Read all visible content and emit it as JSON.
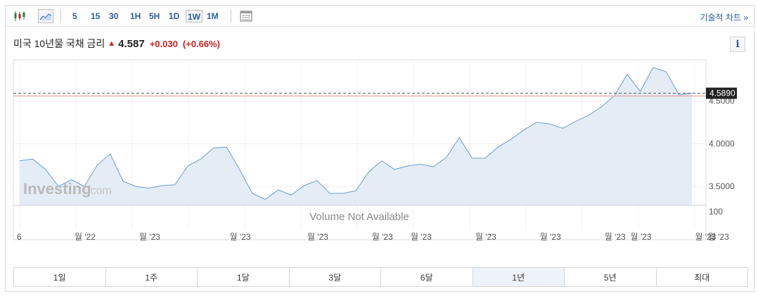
{
  "toolbar": {
    "icons": [
      "candlestick-icon",
      "area-chart-icon",
      "table-icon"
    ],
    "timeframes": [
      "5",
      "15",
      "30",
      "1H",
      "5H",
      "1D",
      "1W",
      "1M"
    ],
    "active_timeframe": "1W",
    "tech_link": "기술적 차트 »"
  },
  "quote": {
    "name": "미국 10년물 국채 금리",
    "price": "4.587",
    "change": "+0.030",
    "change_pct": "(+0.66%)",
    "direction": "up"
  },
  "info_label": "i",
  "watermark": "Investing",
  "watermark_suffix": ".com",
  "volume_text": "Volume Not Available",
  "chart_data": {
    "type": "area",
    "y": [
      3.8,
      3.82,
      3.7,
      3.5,
      3.58,
      3.5,
      3.75,
      3.88,
      3.56,
      3.5,
      3.48,
      3.51,
      3.52,
      3.74,
      3.82,
      3.95,
      3.96,
      3.7,
      3.42,
      3.35,
      3.46,
      3.4,
      3.51,
      3.57,
      3.42,
      3.42,
      3.45,
      3.67,
      3.8,
      3.7,
      3.74,
      3.76,
      3.73,
      3.84,
      4.07,
      3.83,
      3.83,
      3.96,
      4.05,
      4.16,
      4.25,
      4.23,
      4.18,
      4.26,
      4.33,
      4.43,
      4.56,
      4.81,
      4.61,
      4.89,
      4.84,
      4.57,
      4.59
    ],
    "ylim": [
      3.28,
      4.98
    ],
    "y_ticks": [
      {
        "value": 3.5,
        "label": "3.5000"
      },
      {
        "value": 4.0,
        "label": "4.0000"
      },
      {
        "value": 4.5,
        "label": "4.5000"
      }
    ],
    "last_value": 4.589,
    "last_value_label": "4.5890",
    "reference_value": 4.557,
    "volume_axis_label": "100",
    "x_labels": [
      "6",
      "월 '22",
      "월 '23",
      "월 '23",
      "월 '23",
      "월 '23",
      "월 '23",
      "월 '23",
      "월 '23",
      "월 '23",
      "월 '23",
      "월 '23",
      "월 '23"
    ],
    "x_label_idx": [
      0,
      5,
      10,
      17,
      23,
      28,
      31,
      36,
      41,
      46,
      48,
      53,
      54
    ],
    "colors": {
      "line": "#6f9fcf",
      "fill": "#e4ecf6",
      "reference": "#e8a3a3",
      "last_box": "#222222"
    }
  },
  "ranges": {
    "items": [
      "1일",
      "1주",
      "1달",
      "3달",
      "6달",
      "1년",
      "5년",
      "최대"
    ],
    "active": "1년"
  }
}
